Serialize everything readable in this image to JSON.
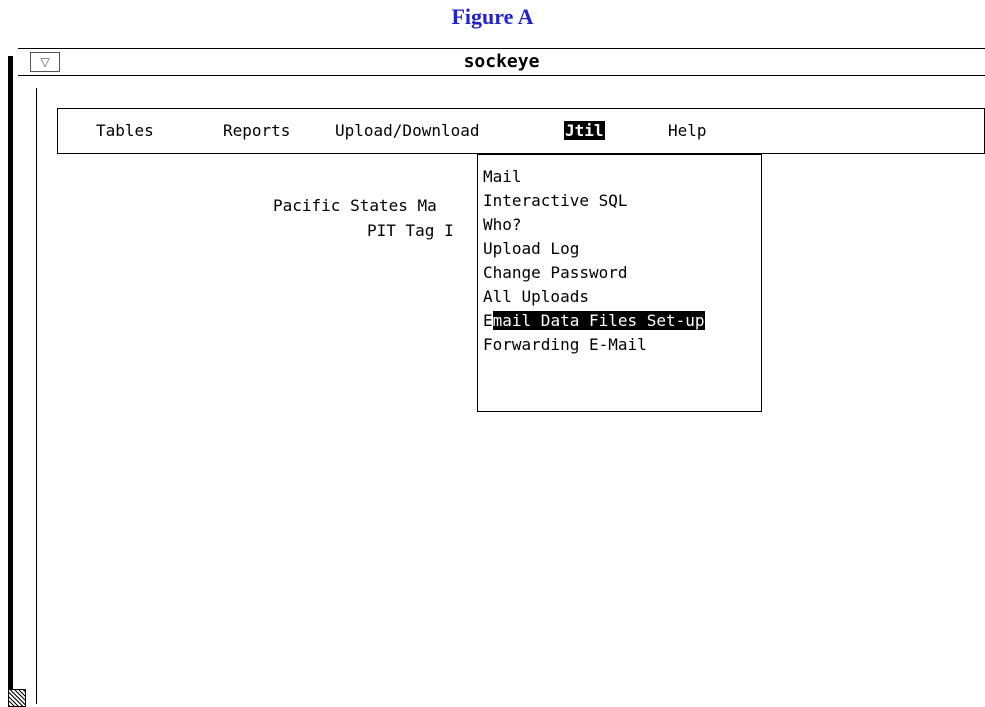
{
  "figure": {
    "caption": "Figure A"
  },
  "window": {
    "title": "sockeye",
    "menu_button_glyph": "▽"
  },
  "menubar": {
    "items": [
      {
        "label": "Tables"
      },
      {
        "label": "Reports"
      },
      {
        "label": "Upload/Download"
      },
      {
        "label_hl": "Jtil",
        "label_rest": ""
      },
      {
        "label": "Help"
      }
    ]
  },
  "content": {
    "line1": "Pacific States Ma",
    "line2": "PIT Tag I"
  },
  "util_menu": {
    "items": [
      {
        "label": "Mail"
      },
      {
        "label": "Interactive SQL"
      },
      {
        "label": "Who?"
      },
      {
        "label": "Upload Log"
      },
      {
        "label": "Change Password"
      },
      {
        "label": "All Uploads"
      },
      {
        "first": "E",
        "rest": "mail Data Files Set-up",
        "active": true
      },
      {
        "label": "Forwarding E-Mail"
      }
    ]
  },
  "colors": {
    "caption": "#2222cc",
    "highlight_bg": "#000000",
    "highlight_fg": "#ffffff"
  }
}
